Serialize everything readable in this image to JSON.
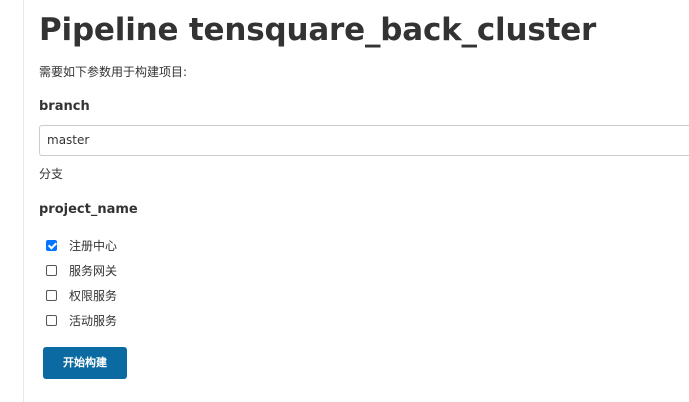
{
  "page": {
    "title": "Pipeline tensquare_back_cluster",
    "instruction": "需要如下参数用于构建项目:"
  },
  "parameters": {
    "branch": {
      "name": "branch",
      "value": "master",
      "description": "分支"
    },
    "project_name": {
      "name": "project_name",
      "options": [
        {
          "label": "注册中心",
          "checked": true
        },
        {
          "label": "服务网关",
          "checked": false
        },
        {
          "label": "权限服务",
          "checked": false
        },
        {
          "label": "活动服务",
          "checked": false
        }
      ]
    }
  },
  "actions": {
    "build_label": "开始构建"
  },
  "colors": {
    "button": "#0b6aa2",
    "checkbox_checked": "#0075ff",
    "text": "#333333"
  }
}
